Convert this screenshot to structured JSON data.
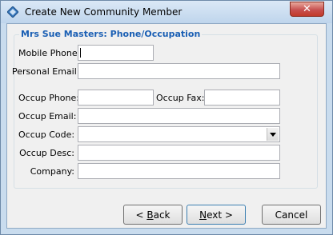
{
  "window": {
    "title": "Create New Community Member",
    "close_glyph": "✕"
  },
  "group": {
    "title": "Mrs Sue Masters: Phone/Occupation"
  },
  "fields": {
    "mobile_phone": {
      "label": "Mobile Phone:",
      "value": ""
    },
    "personal_email": {
      "label": "Personal Email:",
      "value": ""
    },
    "occup_phone": {
      "label": "Occup Phone:",
      "value": ""
    },
    "occup_fax": {
      "label": "Occup Fax:",
      "value": ""
    },
    "occup_email": {
      "label": "Occup Email:",
      "value": ""
    },
    "occup_code": {
      "label": "Occup Code:",
      "value": ""
    },
    "occup_desc": {
      "label": "Occup Desc:",
      "value": ""
    },
    "company": {
      "label": "Company:",
      "value": ""
    }
  },
  "buttons": {
    "back": {
      "label_prefix": "< ",
      "label_accel": "B",
      "label_rest": "ack"
    },
    "next": {
      "label_accel": "N",
      "label_rest": "ext >"
    },
    "cancel": {
      "label": "Cancel"
    }
  },
  "colors": {
    "group_title": "#1a5fb4",
    "close_button": "#c75050"
  }
}
